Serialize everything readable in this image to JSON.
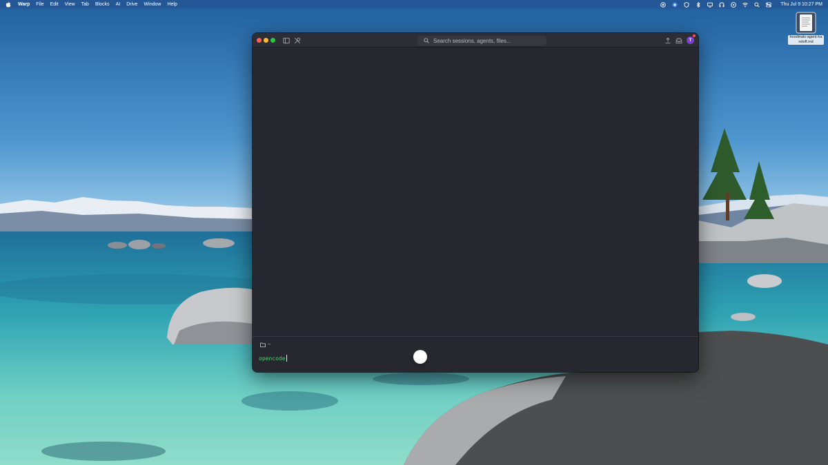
{
  "menubar": {
    "app_name": "Warp",
    "menus": [
      "File",
      "Edit",
      "View",
      "Tab",
      "Blocks",
      "AI",
      "Drive",
      "Window",
      "Help"
    ],
    "status_icons": [
      "screen-record-icon",
      "control-icon",
      "vpn-icon",
      "bluetooth-icon",
      "display-icon",
      "headphones-icon",
      "play-icon",
      "wifi-icon",
      "search-icon",
      "control-center-icon"
    ],
    "clock": "Thu Jul 9  10:27 PM"
  },
  "desktop": {
    "file_label": "hoodinals-agent-handoff.md"
  },
  "window": {
    "search_placeholder": "Search sessions, agents, files...",
    "avatar_initial": "T",
    "directory": "~",
    "command": "opencode"
  },
  "colors": {
    "window_bg": "#27272f",
    "titlebar_bg": "#2d2d35",
    "command_green": "#4bd36d",
    "avatar_purple": "#7b3fd0",
    "close": "#ff5f57",
    "minimize": "#febc2e",
    "zoom": "#28c840"
  }
}
